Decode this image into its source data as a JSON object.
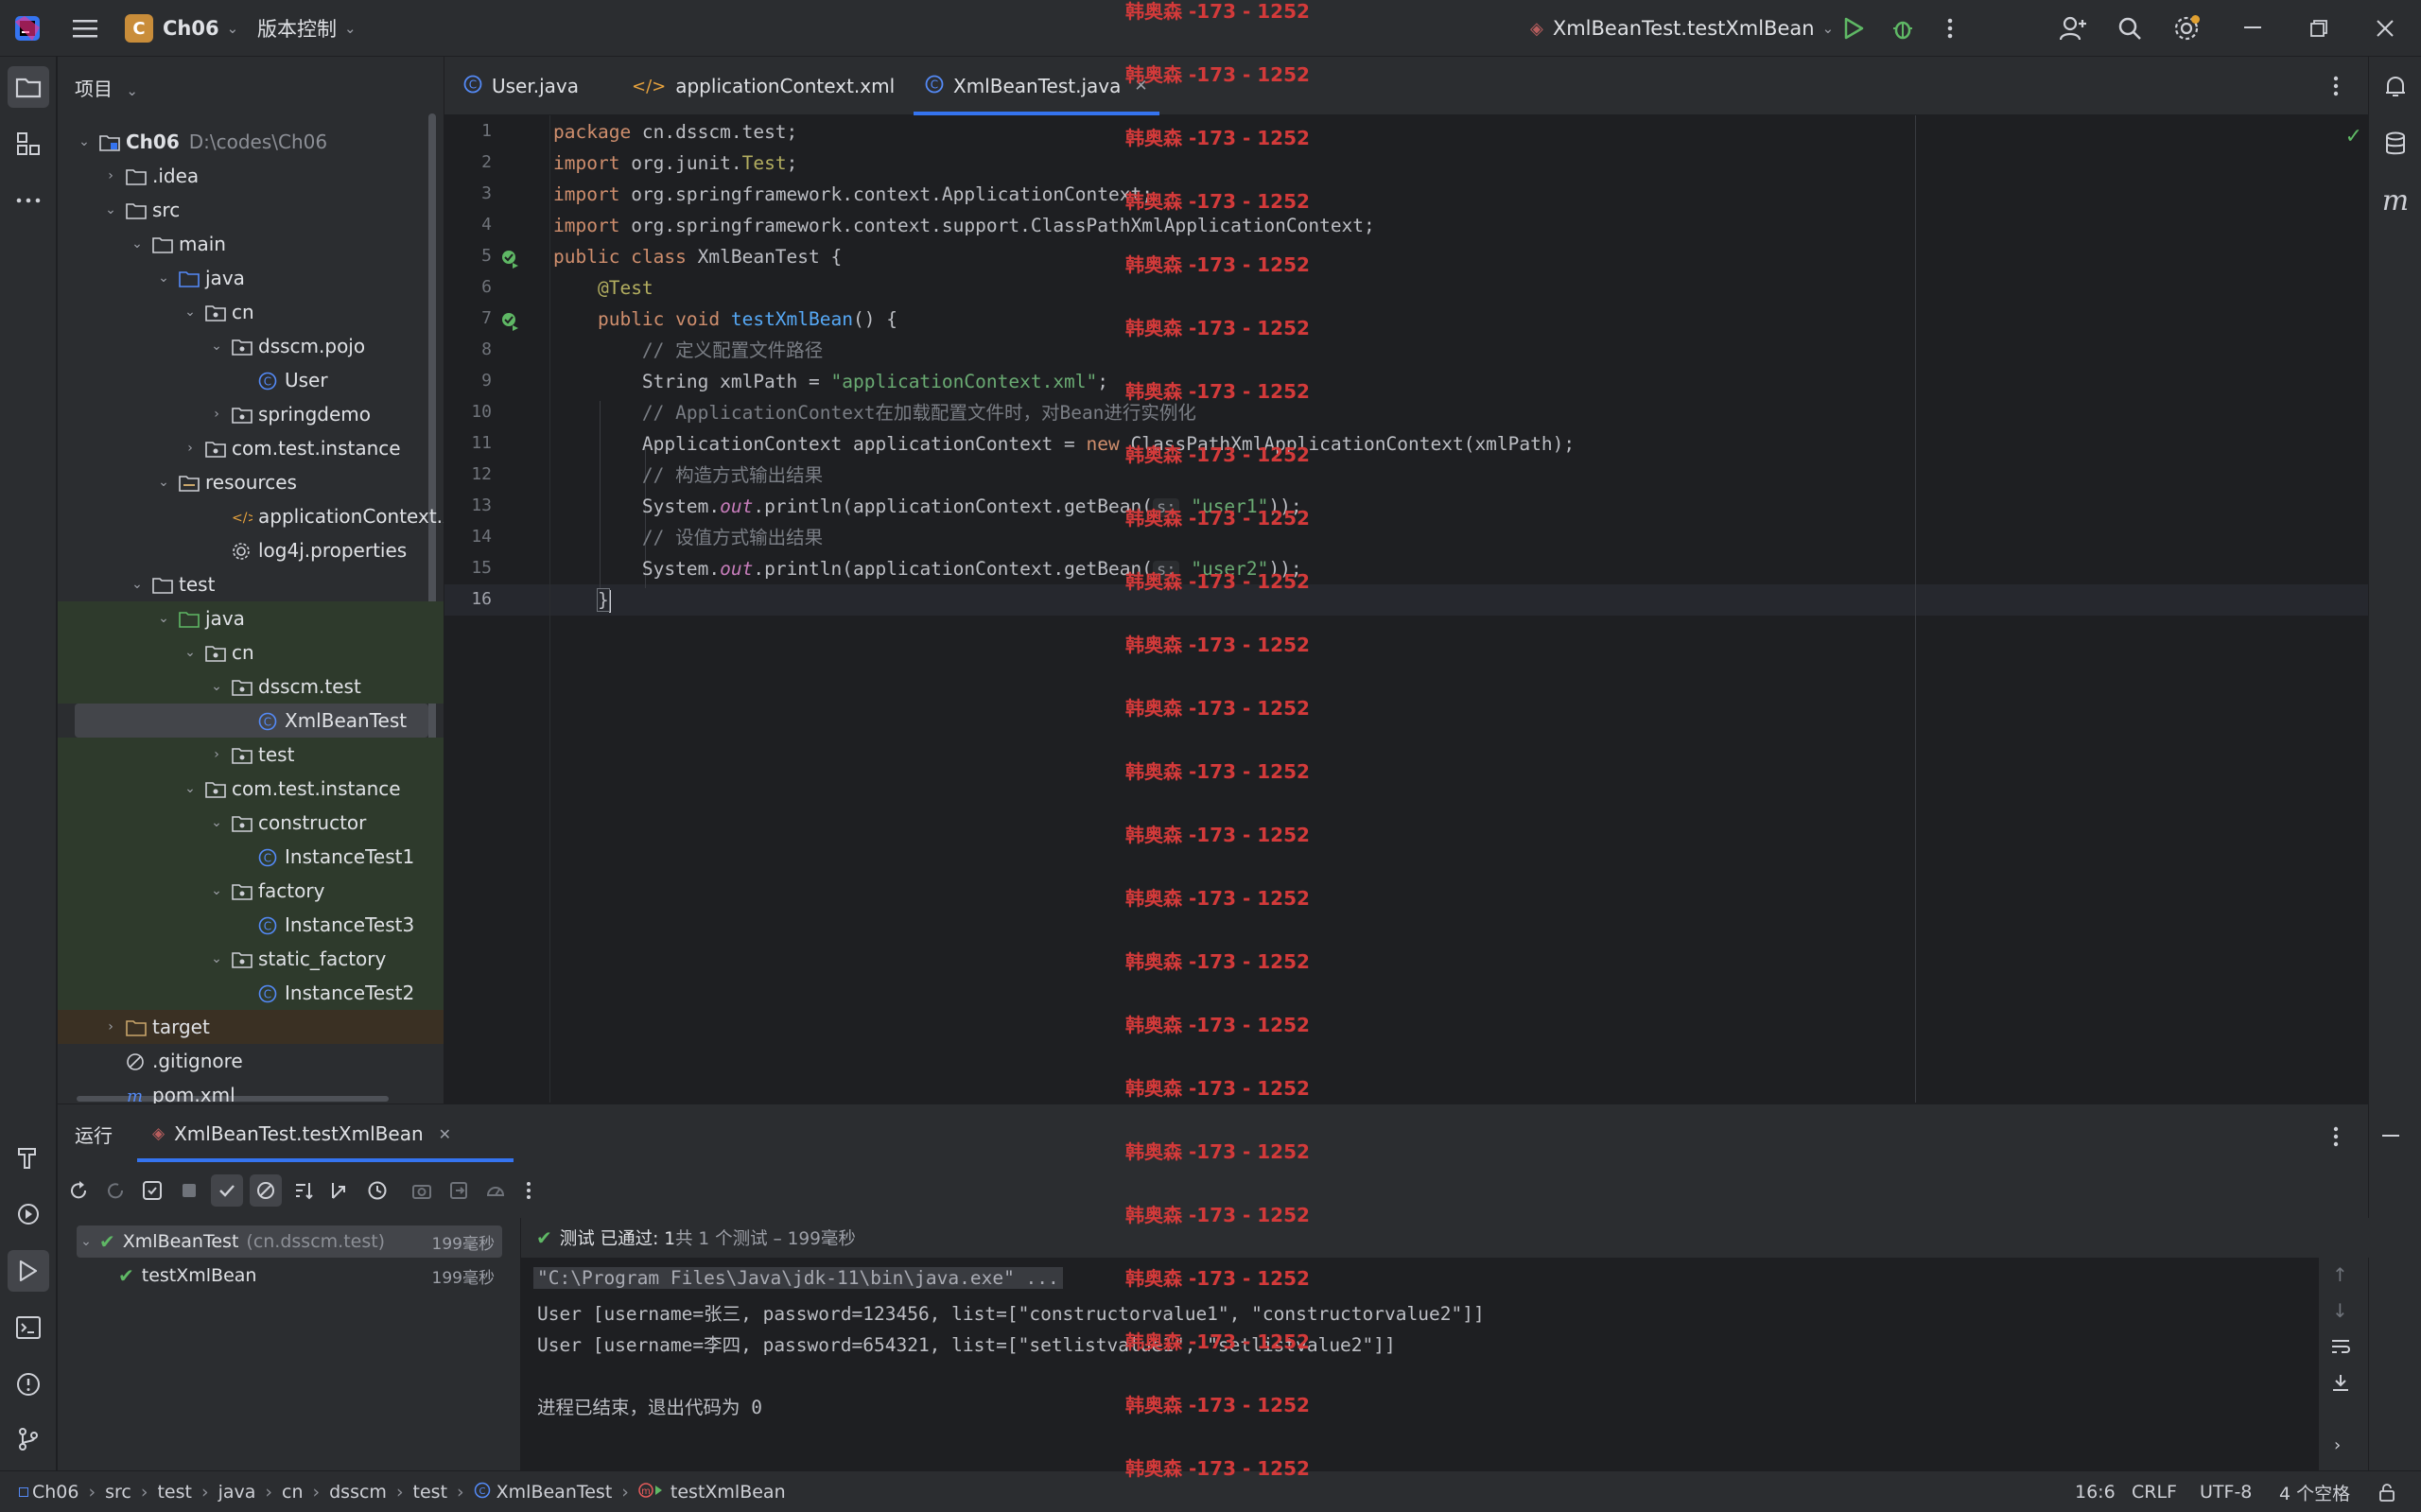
{
  "titlebar": {
    "project_letter": "C",
    "project_name": "Ch06",
    "vcs_menu": "版本控制",
    "run_config": "XmlBeanTest.testXmlBean"
  },
  "project_panel": {
    "title": "项目",
    "tree": [
      {
        "label": "Ch06",
        "hint": "D:\\codes\\Ch06",
        "bold": true
      },
      {
        "label": ".idea"
      },
      {
        "label": "src"
      },
      {
        "label": "main"
      },
      {
        "label": "java"
      },
      {
        "label": "cn"
      },
      {
        "label": "dsscm.pojo"
      },
      {
        "label": "User"
      },
      {
        "label": "springdemo"
      },
      {
        "label": "com.test.instance"
      },
      {
        "label": "resources"
      },
      {
        "label": "applicationContext.xml"
      },
      {
        "label": "log4j.properties"
      },
      {
        "label": "test"
      },
      {
        "label": "java"
      },
      {
        "label": "cn"
      },
      {
        "label": "dsscm.test"
      },
      {
        "label": "XmlBeanTest"
      },
      {
        "label": "test"
      },
      {
        "label": "com.test.instance"
      },
      {
        "label": "constructor"
      },
      {
        "label": "InstanceTest1"
      },
      {
        "label": "factory"
      },
      {
        "label": "InstanceTest3"
      },
      {
        "label": "static_factory"
      },
      {
        "label": "InstanceTest2"
      },
      {
        "label": "target"
      },
      {
        "label": ".gitignore"
      },
      {
        "label": "pom.xml"
      }
    ]
  },
  "tabs": [
    {
      "label": "User.java"
    },
    {
      "label": "applicationContext.xml"
    },
    {
      "label": "XmlBeanTest.java",
      "active": true
    }
  ],
  "editor": {
    "line_numbers": [
      "1",
      "2",
      "3",
      "4",
      "5",
      "6",
      "7",
      "8",
      "9",
      "10",
      "11",
      "12",
      "13",
      "14",
      "15",
      "16"
    ],
    "code": {
      "l1_kw": "package",
      "l1_rest": " cn.dsscm.test;",
      "l2_kw": "import",
      "l2_rest": " org.junit.",
      "l2_ann": "Test",
      "l2_end": ";",
      "l3_kw": "import",
      "l3_rest": " org.springframework.context.ApplicationContext;",
      "l4_kw": "import",
      "l4_rest": " org.springframework.context.support.ClassPathXmlApplicationContext;",
      "l5_kw": "public class",
      "l5_rest": " XmlBeanTest {",
      "l6_ann": "@Test",
      "l7_kw": "public void",
      "l7_fn": " testXmlBean",
      "l7_rest": "() {",
      "l8_cmt": "// 定义配置文件路径",
      "l9_rest": "String xmlPath = ",
      "l9_str": "\"applicationContext.xml\"",
      "l9_end": ";",
      "l10_cmt": "// ApplicationContext在加载配置文件时，对Bean进行实例化",
      "l11_rest": "ApplicationContext applicationContext = ",
      "l11_kw": "new",
      "l11_end": " ClassPathXmlApplicationContext(xmlPath);",
      "l12_cmt": "// 构造方式输出结果",
      "l13_a": "System.",
      "l13_out": "out",
      "l13_b": ".println(applicationContext.getBean(",
      "l13_hint": "s:",
      "l13_str": " \"user1\"",
      "l13_end": "));",
      "l14_cmt": "// 设值方式输出结果",
      "l15_a": "System.",
      "l15_out": "out",
      "l15_b": ".println(applicationContext.getBean(",
      "l15_hint": "s:",
      "l15_str": " \"user2\"",
      "l15_end": "));",
      "l16": "}"
    }
  },
  "watermark": "韩奥森 -173 - 1252",
  "run_panel": {
    "title": "运行",
    "tab_label": "XmlBeanTest.testXmlBean",
    "tests": [
      {
        "name": "XmlBeanTest",
        "pkg": "(cn.dsscm.test)",
        "time": "199毫秒"
      },
      {
        "name": "testXmlBean",
        "time": "199毫秒"
      }
    ],
    "status_passed": "测试 已通过: 1",
    "status_detail": "共 1 个测试 – 199毫秒",
    "console": [
      "\"C:\\Program Files\\Java\\jdk-11\\bin\\java.exe\" ...",
      "User [username=张三, password=123456, list=[\"constructorvalue1\", \"constructorvalue2\"]]",
      "User [username=李四, password=654321, list=[\"setlistvalue1\", \"setlistvalue2\"]]",
      "",
      "进程已结束，退出代码为 0"
    ]
  },
  "statusbar": {
    "breadcrumbs": [
      "Ch06",
      "src",
      "test",
      "java",
      "cn",
      "dsscm",
      "test",
      "XmlBeanTest",
      "testXmlBean"
    ],
    "position": "16:6",
    "line_sep": "CRLF",
    "encoding": "UTF-8",
    "indent": "4 个空格"
  },
  "colors": {
    "accent": "#3574f0",
    "success": "#5fb865",
    "watermark": "#d33a3a"
  }
}
